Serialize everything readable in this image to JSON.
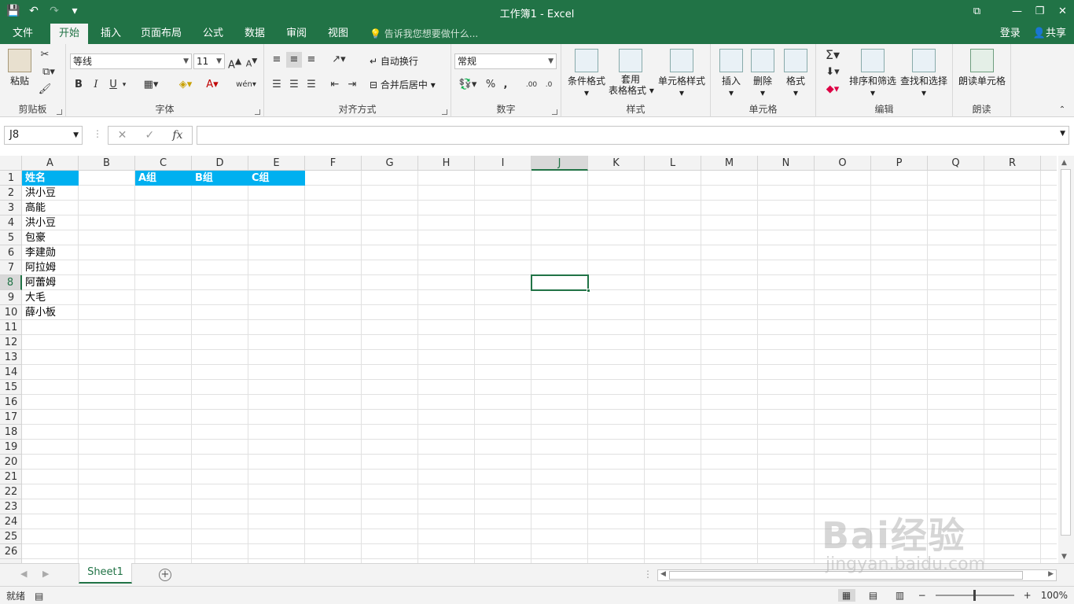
{
  "window": {
    "title": "工作簿1 - Excel"
  },
  "quick_access": {
    "save": "💾",
    "undo": "↶",
    "redo": "↷",
    "customize": "▾"
  },
  "window_buttons": {
    "ribbon_opts": "⧉",
    "min": "—",
    "restore": "❐",
    "close": "✕"
  },
  "tabs": [
    {
      "label": "文件"
    },
    {
      "label": "开始"
    },
    {
      "label": "插入"
    },
    {
      "label": "页面布局"
    },
    {
      "label": "公式"
    },
    {
      "label": "数据"
    },
    {
      "label": "审阅"
    },
    {
      "label": "视图"
    }
  ],
  "active_tab": "开始",
  "tell_me": "告诉我您想要做什么...",
  "account": {
    "login": "登录",
    "share": "共享"
  },
  "ribbon": {
    "clipboard": {
      "label": "剪贴板",
      "paste": "粘贴"
    },
    "font": {
      "label": "字体",
      "name": "等线",
      "size": "11",
      "bold": "B",
      "italic": "I",
      "underline": "U",
      "grow": "A",
      "shrink": "A",
      "wen": "wén"
    },
    "alignment": {
      "label": "对齐方式",
      "wrap": "自动换行",
      "merge": "合并后居中"
    },
    "number": {
      "label": "数字",
      "format": "常规",
      "percent": "%",
      "comma": ",",
      "inc": ".00",
      "dec": ".0"
    },
    "styles": {
      "label": "样式",
      "conditional": "条件格式",
      "table": "套用",
      "table2": "表格格式",
      "cell_styles": "单元格样式"
    },
    "cells": {
      "label": "单元格",
      "insert": "插入",
      "delete": "删除",
      "format": "格式"
    },
    "editing": {
      "label": "编辑",
      "sort": "排序和筛选",
      "find": "查找和选择"
    },
    "read": {
      "label": "朗读",
      "read_cell": "朗读单元格"
    }
  },
  "formula_bar": {
    "name_box": "J8",
    "formula": "",
    "fx": "fx"
  },
  "columns": [
    "A",
    "B",
    "C",
    "D",
    "E",
    "F",
    "G",
    "H",
    "I",
    "J",
    "K",
    "L",
    "M",
    "N",
    "O",
    "P",
    "Q",
    "R"
  ],
  "rows": [
    "1",
    "2",
    "3",
    "4",
    "5",
    "6",
    "7",
    "8",
    "9",
    "10",
    "11",
    "12",
    "13",
    "14",
    "15",
    "16",
    "17",
    "18",
    "19",
    "20",
    "21",
    "22",
    "23",
    "24",
    "25",
    "26"
  ],
  "selected": {
    "col": "J",
    "row": "8"
  },
  "cells": {
    "A": [
      "姓名",
      "洪小豆",
      "高能",
      "洪小豆",
      "包豪",
      "李建勋",
      "阿拉姆",
      "阿蕾姆",
      "大毛",
      "薛小板"
    ],
    "C1": "A组",
    "D1": "B组",
    "E1": "C组"
  },
  "colors": {
    "excel_green": "#217346",
    "header_fill": "#00b0f0"
  },
  "sheet_tabs": [
    {
      "label": "Sheet1"
    }
  ],
  "status": {
    "ready": "就绪",
    "zoom": "100%"
  },
  "watermark": {
    "text": "Bai经验",
    "url": "jingyan.baidu.com"
  }
}
